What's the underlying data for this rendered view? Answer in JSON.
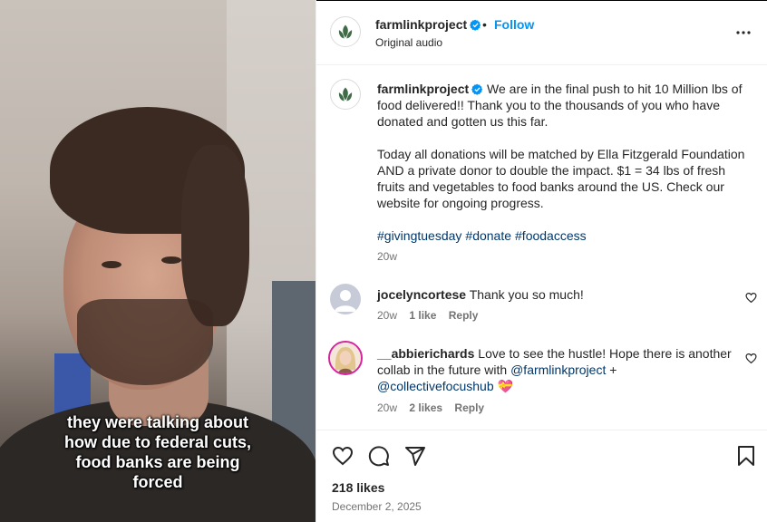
{
  "post": {
    "username": "farmlinkproject",
    "follow_label": "Follow",
    "separator": "•",
    "audio": "Original audio",
    "caption": {
      "paragraph1": "We are in the final push to hit 10 Million lbs of food delivered!! Thank you to the thousands of you who have donated and gotten us this far.",
      "paragraph2": "Today all donations will be matched by Ella Fitzgerald Foundation AND a private donor to double the impact. $1 = 34 lbs of fresh fruits and vegetables to food banks around the US. Check our website for ongoing progress.",
      "hashtags": [
        "#givingtuesday",
        "#donate",
        "#foodaccess"
      ],
      "time": "20w"
    },
    "likes": "218 likes",
    "date": "December 2, 2025"
  },
  "video": {
    "caption_lines": [
      "they were talking about",
      "how due to federal cuts,",
      "food banks are being",
      "forced"
    ]
  },
  "comments": [
    {
      "username": "jocelyncortese",
      "text": "Thank you so much!",
      "time": "20w",
      "likes": "1 like",
      "reply_label": "Reply"
    },
    {
      "username": "__abbierichards",
      "text_before": "Love to see the hustle! Hope there is another collab in the future with",
      "mention1": "@farmlinkproject",
      "text_middle": "+",
      "mention2": "@collectivefocushub",
      "emoji": "💝",
      "time": "20w",
      "likes": "2 likes",
      "reply_label": "Reply"
    }
  ],
  "icons": {
    "more": "more-options-icon",
    "like": "heart-icon",
    "comment": "comment-icon",
    "share": "share-icon",
    "save": "bookmark-icon",
    "verified": "verified-badge-icon"
  },
  "colors": {
    "accent": "#0095f6",
    "link": "#00376b",
    "logo_green": "#3f6b47",
    "verified": "#0095f6"
  }
}
